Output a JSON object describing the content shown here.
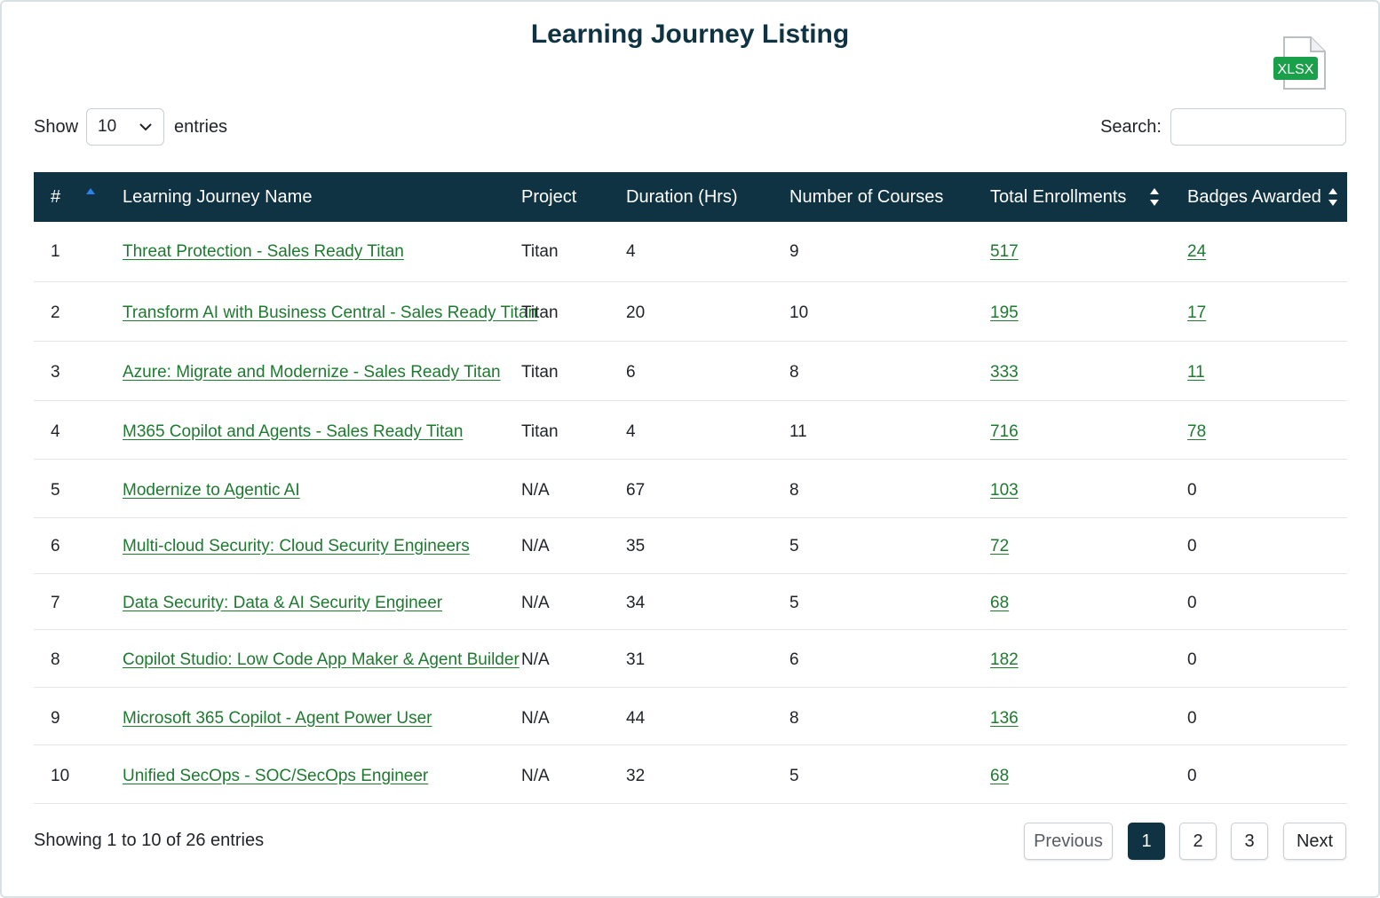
{
  "title": "Learning Journey Listing",
  "export": {
    "label": "XLSX",
    "icon": "xlsx-file-icon",
    "accent": "#1aa04a"
  },
  "length": {
    "prefix": "Show",
    "value": "10",
    "suffix": "entries"
  },
  "search": {
    "label": "Search:",
    "value": "",
    "placeholder": ""
  },
  "columns": [
    "#",
    "Learning Journey Name",
    "Project",
    "Duration (Hrs)",
    "Number of Courses",
    "Total Enrollments",
    "Badges Awarded"
  ],
  "rows": [
    {
      "num": "1",
      "name": "Threat Protection - Sales Ready Titan",
      "project": "Titan",
      "duration": "4",
      "courses": "9",
      "enrollments": "517",
      "badges": "24",
      "badges_link": true
    },
    {
      "num": "2",
      "name": "Transform AI with Business Central - Sales Ready Titan",
      "project": "Titan",
      "duration": "20",
      "courses": "10",
      "enrollments": "195",
      "badges": "17",
      "badges_link": true
    },
    {
      "num": "3",
      "name": "Azure: Migrate and Modernize - Sales Ready Titan",
      "project": "Titan",
      "duration": "6",
      "courses": "8",
      "enrollments": "333",
      "badges": "11",
      "badges_link": true
    },
    {
      "num": "4",
      "name": "M365 Copilot and Agents - Sales Ready Titan",
      "project": "Titan",
      "duration": "4",
      "courses": "11",
      "enrollments": "716",
      "badges": "78",
      "badges_link": true
    },
    {
      "num": "5",
      "name": "Modernize to Agentic AI",
      "project": "N/A",
      "duration": "67",
      "courses": "8",
      "enrollments": "103",
      "badges": "0",
      "badges_link": false
    },
    {
      "num": "6",
      "name": "Multi-cloud Security: Cloud Security Engineers",
      "project": "N/A",
      "duration": "35",
      "courses": "5",
      "enrollments": "72",
      "badges": "0",
      "badges_link": false
    },
    {
      "num": "7",
      "name": "Data Security: Data & AI Security Engineer",
      "project": "N/A",
      "duration": "34",
      "courses": "5",
      "enrollments": "68",
      "badges": "0",
      "badges_link": false
    },
    {
      "num": "8",
      "name": "Copilot Studio: Low Code App Maker & Agent Builder",
      "project": "N/A",
      "duration": "31",
      "courses": "6",
      "enrollments": "182",
      "badges": "0",
      "badges_link": false
    },
    {
      "num": "9",
      "name": "Microsoft 365 Copilot - Agent Power User",
      "project": "N/A",
      "duration": "44",
      "courses": "8",
      "enrollments": "136",
      "badges": "0",
      "badges_link": false
    },
    {
      "num": "10",
      "name": "Unified SecOps - SOC/SecOps Engineer",
      "project": "N/A",
      "duration": "32",
      "courses": "5",
      "enrollments": "68",
      "badges": "0",
      "badges_link": false
    }
  ],
  "info": "Showing 1 to 10 of 26 entries",
  "pagination": {
    "previous": "Previous",
    "pages": [
      "1",
      "2",
      "3"
    ],
    "current": "1",
    "next": "Next"
  },
  "colors": {
    "header_bg": "#0f3342",
    "link": "#1d7a2f",
    "sort_active": "#2f80ed"
  }
}
